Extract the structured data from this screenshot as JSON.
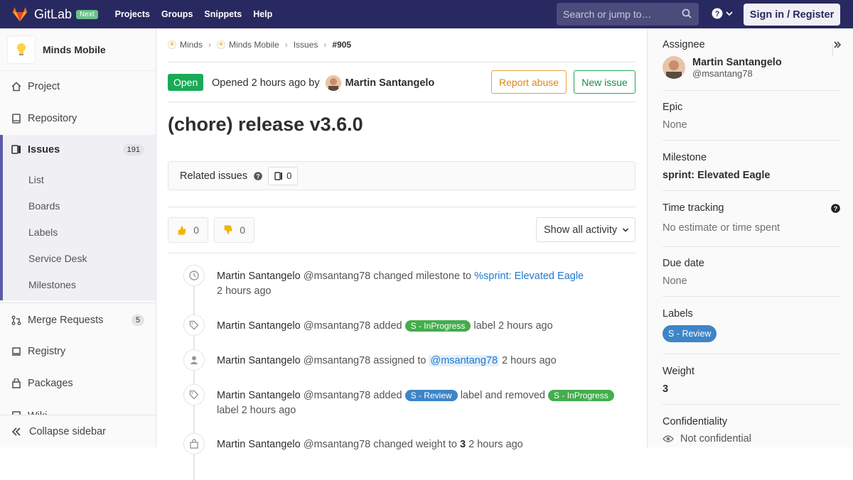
{
  "topbar": {
    "brand": "GitLab",
    "badge": "Next",
    "nav": [
      "Projects",
      "Groups",
      "Snippets",
      "Help"
    ],
    "search_placeholder": "Search or jump to…",
    "signin": "Sign in / Register",
    "colors": {
      "bar": "#292961",
      "badge": "#6ac18b"
    }
  },
  "sidebar": {
    "project_name": "Minds Mobile",
    "items": [
      {
        "label": "Project",
        "icon": "home-icon"
      },
      {
        "label": "Repository",
        "icon": "doc-icon"
      },
      {
        "label": "Issues",
        "icon": "issues-icon",
        "count": "191"
      },
      {
        "label": "Merge Requests",
        "icon": "merge-icon",
        "count": "5"
      },
      {
        "label": "Registry",
        "icon": "container-icon"
      },
      {
        "label": "Packages",
        "icon": "package-icon"
      },
      {
        "label": "Wiki",
        "icon": "book-icon"
      }
    ],
    "issues_sub": [
      "List",
      "Boards",
      "Labels",
      "Service Desk",
      "Milestones"
    ],
    "collapse": "Collapse sidebar"
  },
  "breadcrumb": {
    "items": [
      "Minds",
      "Minds Mobile",
      "Issues"
    ],
    "current": "#905"
  },
  "issue": {
    "status": "Open",
    "opened_prefix": "Opened",
    "opened_time": "2 hours ago",
    "by": "by",
    "author": "Martin Santangelo",
    "report_abuse": "Report abuse",
    "new_issue": "New issue",
    "title": "(chore) release v3.6.0",
    "related_label": "Related issues",
    "related_count": "0",
    "thumbs_up": "0",
    "thumbs_down": "0",
    "activity_filter": "Show all activity"
  },
  "timeline": [
    {
      "who": "Martin Santangelo",
      "handle": "@msantang78",
      "text": "changed milestone to",
      "link": "%sprint: Elevated Eagle",
      "time": "2 hours ago",
      "icon": "clock-icon"
    },
    {
      "who": "Martin Santangelo",
      "handle": "@msantang78",
      "text": "added",
      "label": "S - InProgress",
      "suffix": "label",
      "time": "2 hours ago",
      "icon": "tag-icon"
    },
    {
      "who": "Martin Santangelo",
      "handle": "@msantang78",
      "text": "assigned to",
      "mention": "@msantang78",
      "time": "2 hours ago",
      "icon": "user-icon"
    },
    {
      "who": "Martin Santangelo",
      "handle": "@msantang78",
      "text": "added",
      "label": "S - Review",
      "mid": "label and removed",
      "label2": "S - InProgress",
      "suffix": "label",
      "time": "2 hours ago",
      "icon": "tag-icon"
    },
    {
      "who": "Martin Santangelo",
      "handle": "@msantang78",
      "text": "changed weight to",
      "value": "3",
      "time": "2 hours ago",
      "icon": "weight-icon"
    }
  ],
  "right": {
    "assignee_h": "Assignee",
    "assignee_name": "Martin Santangelo",
    "assignee_handle": "@msantang78",
    "epic_h": "Epic",
    "epic_v": "None",
    "milestone_h": "Milestone",
    "milestone_v": "sprint: Elevated Eagle",
    "time_h": "Time tracking",
    "time_v": "No estimate or time spent",
    "due_h": "Due date",
    "due_v": "None",
    "labels_h": "Labels",
    "labels_v": "S - Review",
    "weight_h": "Weight",
    "weight_v": "3",
    "conf_h": "Confidentiality",
    "conf_v": "Not confidential"
  }
}
